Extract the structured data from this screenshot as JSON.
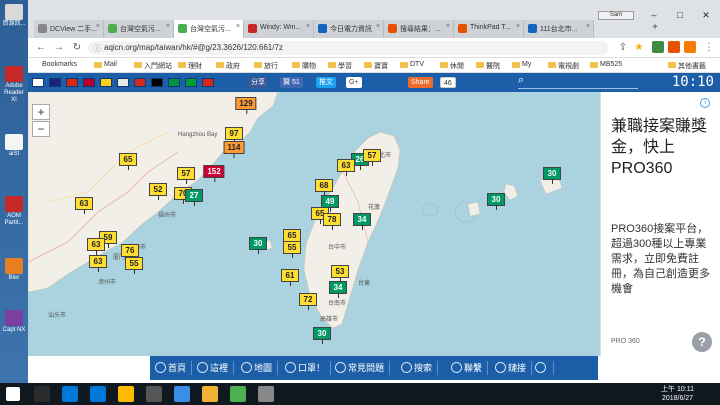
{
  "desktop": {
    "icons": [
      {
        "label": "資源回...",
        "color": "#d9d9d9"
      },
      {
        "label": "Adobe Reader XI",
        "color": "#c62828"
      },
      {
        "label": "aiSt",
        "color": "#f5f5f5"
      },
      {
        "label": "AOM Partit...",
        "color": "#c62828"
      },
      {
        "label": "Bler",
        "color": "#e67e22"
      },
      {
        "label": "Capt NX",
        "color": "#7b3fa0"
      }
    ]
  },
  "browser": {
    "tabs": [
      {
        "title": "DCView 二手...",
        "active": false,
        "favicon": "#888888"
      },
      {
        "title": "台灣空氣污...",
        "active": false,
        "favicon": "#4caf50"
      },
      {
        "title": "台灣空氣污...",
        "active": true,
        "favicon": "#4caf50"
      },
      {
        "title": "Windy: Win...",
        "active": false,
        "favicon": "#c62828"
      },
      {
        "title": "今日電力資訊",
        "active": false,
        "favicon": "#1565c0"
      },
      {
        "title": "搜尋結果：...",
        "active": false,
        "favicon": "#e65100"
      },
      {
        "title": "ThinkPad T...",
        "active": false,
        "favicon": "#e65100"
      },
      {
        "title": "111台北市...",
        "active": false,
        "favicon": "#1565c0"
      }
    ],
    "profile_label": "Sam",
    "url": "aqicn.org/map/taiwan/hk/#@g/23.3626/120.661/7z",
    "bookmarks": [
      {
        "label": "Bookmarks",
        "folder": false
      },
      {
        "label": "Mail",
        "folder": true
      },
      {
        "label": "入門網站",
        "folder": true
      },
      {
        "label": "理財",
        "folder": true
      },
      {
        "label": "政府",
        "folder": true
      },
      {
        "label": "旅行",
        "folder": true
      },
      {
        "label": "購物",
        "folder": true
      },
      {
        "label": "學習",
        "folder": true
      },
      {
        "label": "寶寶",
        "folder": true
      },
      {
        "label": "DTV",
        "folder": true
      },
      {
        "label": "休閒",
        "folder": true
      },
      {
        "label": "醫院",
        "folder": true
      },
      {
        "label": "My",
        "folder": true
      },
      {
        "label": "電視劇",
        "folder": true
      },
      {
        "label": "MB525",
        "folder": true
      },
      {
        "label": "其他書籤",
        "folder": true
      }
    ]
  },
  "site": {
    "flags": [
      "#ffffff",
      "#1a237e",
      "#de2910",
      "#bc002d",
      "#fcd116",
      "#e8e8e8",
      "#d52b1e",
      "#000000",
      "#009246",
      "#009c3b",
      "#da251d"
    ],
    "share_fb_label": "分享",
    "like_label": "贊 51",
    "tweet_label": "推文",
    "gplus_label": "G+",
    "share_label": "Share",
    "share_count": "46",
    "clock": "10:10"
  },
  "map": {
    "zoom_in": "+",
    "zoom_out": "−",
    "labels": [
      {
        "text": "Hangzhou Bay"
      },
      {
        "text": "福州市"
      },
      {
        "text": "泉州市"
      },
      {
        "text": "厦门市"
      },
      {
        "text": "漳州市"
      },
      {
        "text": "汕头市"
      },
      {
        "text": "台北市"
      },
      {
        "text": "台中市"
      },
      {
        "text": "台南市"
      },
      {
        "text": "高雄市"
      },
      {
        "text": "花蓮"
      },
      {
        "text": "台東"
      }
    ],
    "markers": [
      {
        "value": "129",
        "level": "orange"
      },
      {
        "value": "97",
        "level": "yellow"
      },
      {
        "value": "114",
        "level": "orange"
      },
      {
        "value": "65",
        "level": "yellow"
      },
      {
        "value": "57",
        "level": "yellow"
      },
      {
        "value": "152",
        "level": "red"
      },
      {
        "value": "52",
        "level": "yellow"
      },
      {
        "value": "70",
        "level": "yellow"
      },
      {
        "value": "27",
        "level": "green"
      },
      {
        "value": "63",
        "level": "yellow"
      },
      {
        "value": "59",
        "level": "yellow"
      },
      {
        "value": "63",
        "level": "yellow"
      },
      {
        "value": "76",
        "level": "yellow"
      },
      {
        "value": "63",
        "level": "yellow"
      },
      {
        "value": "55",
        "level": "yellow"
      },
      {
        "value": "26",
        "level": "green"
      },
      {
        "value": "57",
        "level": "yellow"
      },
      {
        "value": "63",
        "level": "yellow"
      },
      {
        "value": "68",
        "level": "yellow"
      },
      {
        "value": "49",
        "level": "green"
      },
      {
        "value": "65",
        "level": "yellow"
      },
      {
        "value": "78",
        "level": "yellow"
      },
      {
        "value": "34",
        "level": "green"
      },
      {
        "value": "30",
        "level": "green"
      },
      {
        "value": "65",
        "level": "yellow"
      },
      {
        "value": "55",
        "level": "yellow"
      },
      {
        "value": "61",
        "level": "yellow"
      },
      {
        "value": "53",
        "level": "yellow"
      },
      {
        "value": "34",
        "level": "green"
      },
      {
        "value": "72",
        "level": "yellow"
      },
      {
        "value": "30",
        "level": "green"
      },
      {
        "value": "30",
        "level": "green"
      },
      {
        "value": "30",
        "level": "green"
      }
    ]
  },
  "ad": {
    "info": "i",
    "headline": "兼職接案賺獎金，快上PRO360",
    "body": "PRO360接案平台，超過300種以上專業需求，立即免費註冊，為自己創造更多機會",
    "footer": "PRO 360",
    "cta": "?"
  },
  "sitenav": [
    {
      "label": "首頁"
    },
    {
      "label": "這裡"
    },
    {
      "label": "地圖"
    },
    {
      "label": "口罩！"
    },
    {
      "label": "常見問題"
    },
    {
      "label": "搜索"
    },
    {
      "label": "聯繫"
    },
    {
      "label": "鏈接"
    },
    {
      "label": ""
    }
  ],
  "taskbar": {
    "time": "上午 10:11",
    "date": "2018/6/27",
    "apps": [
      "#ffffff",
      "#2b2b2b",
      "#0078d7",
      "#0078d7",
      "#ffb900",
      "#555555",
      "#3a8ee6",
      "#f2b233",
      "#4caf50",
      "#888888"
    ]
  }
}
